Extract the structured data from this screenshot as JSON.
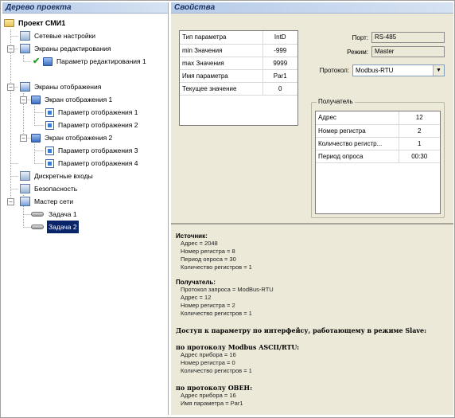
{
  "tree_panel": {
    "title": "Дерево проекта",
    "items": [
      {
        "label": "Проект СМИ1",
        "icon": "folder-icon"
      },
      {
        "label": "Сетевые настройки",
        "icon": "network-settings-icon"
      },
      {
        "label": "Экраны редактирования",
        "icon": "screens-icon"
      },
      {
        "label": "Параметр редактирования 1",
        "icon": "edit-parameter-icon"
      },
      {
        "label": "Экраны отображения",
        "icon": "screens-icon"
      },
      {
        "label": "Экран отображения 1",
        "icon": "screen-icon"
      },
      {
        "label": "Параметр отображения 1",
        "icon": "parameter-icon"
      },
      {
        "label": "Параметр отображения 2",
        "icon": "parameter-icon"
      },
      {
        "label": "Экран отображения 2",
        "icon": "screen-icon"
      },
      {
        "label": "Параметр отображения 3",
        "icon": "parameter-icon"
      },
      {
        "label": "Параметр отображения 4",
        "icon": "parameter-icon"
      },
      {
        "label": "Дискретные входы",
        "icon": "discrete-inputs-icon"
      },
      {
        "label": "Безопасность",
        "icon": "security-icon"
      },
      {
        "label": "Мастер сети",
        "icon": "network-master-icon"
      },
      {
        "label": "Задача 1",
        "icon": "task-icon"
      },
      {
        "label": "Задача 2",
        "icon": "task-icon"
      }
    ],
    "selected": "Задача 2"
  },
  "props_panel": {
    "title": "Свойства",
    "parameter_table": [
      {
        "name": "Тип параметра",
        "value": "IntD"
      },
      {
        "name": "min Значения",
        "value": "-999"
      },
      {
        "name": "max Значения",
        "value": "9999"
      },
      {
        "name": "Имя параметра",
        "value": "Par1"
      },
      {
        "name": "Текущее значение",
        "value": "0"
      }
    ],
    "port": {
      "label": "Порт:",
      "value": "RS-485"
    },
    "mode": {
      "label": "Режим:",
      "value": "Master"
    },
    "protocol": {
      "label": "Протокол:",
      "value": "Modbus-RTU"
    },
    "receiver": {
      "legend": "Получатель",
      "rows": [
        {
          "name": "Адрес",
          "value": "12"
        },
        {
          "name": "Номер регистра",
          "value": "2"
        },
        {
          "name": "Количество регистр...",
          "value": "1"
        },
        {
          "name": "Период опроса",
          "value": "00:30"
        }
      ]
    }
  },
  "info": {
    "source_title": "Источник:",
    "source_lines": [
      "Адрес = 2048",
      "Номер регистра = 8",
      "Период опроса = 30",
      "Количество регистров = 1"
    ],
    "receiver_title": "Получатель:",
    "receiver_lines": [
      "Протокол запроса = ModBus-RTU",
      "Адрес = 12",
      "Номер регистра = 2",
      "Количество регистров = 1"
    ],
    "access_title": "Доступ к параметру по интерфейсу, работающему в режиме Slave:",
    "modbus_title": "по протоколу Modbus ASCII/RTU:",
    "modbus_lines": [
      "Адрес прибора = 16",
      "Номер регистра = 0",
      "Количество регистров = 1"
    ],
    "oven_title": "по протоколу ОВЕН:",
    "oven_lines": [
      "Адрес прибора = 16",
      "Имя параметра = Par1"
    ]
  }
}
